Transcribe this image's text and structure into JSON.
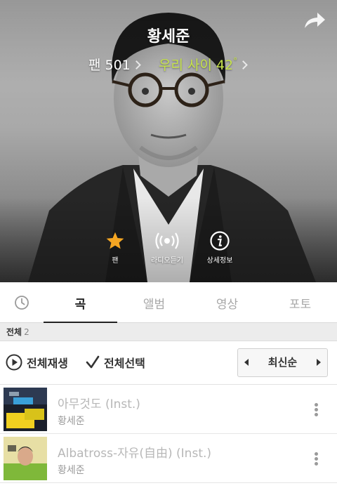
{
  "hero": {
    "artist_name": "황세준",
    "fan_label": "팬",
    "fan_count": "501",
    "relationship_label": "우리 사이",
    "relationship_value": "42",
    "relationship_unit": "°",
    "accent_color": "#c6e34b",
    "actions": [
      {
        "label": "팬",
        "icon": "star-icon"
      },
      {
        "label": "라디오듣기",
        "icon": "radio-icon"
      },
      {
        "label": "상세정보",
        "icon": "info-icon"
      }
    ]
  },
  "tabs": {
    "recent_icon": "clock-icon",
    "items": [
      "곡",
      "앨범",
      "영상",
      "포토"
    ],
    "active": "곡"
  },
  "list_header": {
    "label": "전체",
    "count": "2"
  },
  "toolbar": {
    "play_all": "전체재생",
    "select_all": "전체선택",
    "sort_value": "최신순"
  },
  "songs": [
    {
      "title": "아무것도 (Inst.)",
      "artist": "황세준"
    },
    {
      "title": "Albatross-자유(自由) (Inst.)",
      "artist": "황세준"
    }
  ]
}
